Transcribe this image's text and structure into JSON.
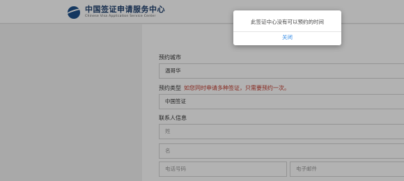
{
  "header": {
    "logo_cn": "中国签证申请服务中心",
    "logo_en": "Chinese Visa Application Service Center"
  },
  "form": {
    "city_label": "预约城市",
    "city_value": "温哥华",
    "type_label": "预约类型",
    "type_note": "如您同时申请多种签证，只需要预约一次。",
    "type_value": "中国签证",
    "contact_label": "联系人信息",
    "surname_placeholder": "姓",
    "given_name_placeholder": "名",
    "phone_placeholder": "电话号码",
    "email_placeholder": "电子邮件"
  },
  "modal": {
    "message": "此签证中心没有可以预约的时间",
    "close_label": "关闭"
  },
  "colors": {
    "note": "#c0392b",
    "link": "#3a8ee6",
    "logo": "#1e4f8a"
  }
}
